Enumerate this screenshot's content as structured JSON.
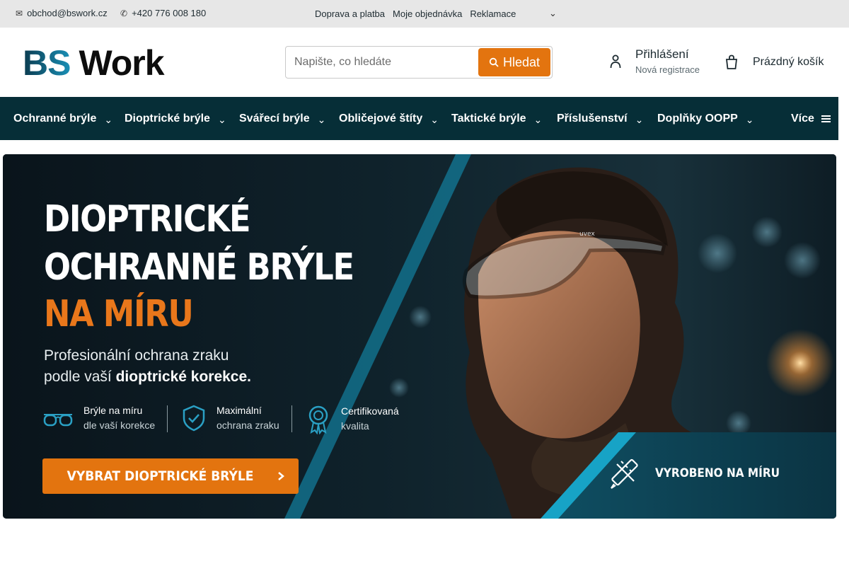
{
  "topbar": {
    "email": "obchod@bswork.cz",
    "email_icon": "mail-icon",
    "phone": "+420 776 008 180",
    "phone_icon": "phone-icon",
    "links": [
      "Doprava a platba",
      "Moje objednávka",
      "Reklamace"
    ],
    "more_icon": "chevron-down-icon"
  },
  "header": {
    "logo_bs": "BS",
    "logo_work": "Work",
    "search_placeholder": "Napište, co hledáte",
    "search_button": "Hledat",
    "login_title": "Přihlášení",
    "login_sub": "Nová registrace",
    "cart_label": "Prázdný košík"
  },
  "nav": {
    "items": [
      "Ochranné brýle",
      "Dioptrické brýle",
      "Svářecí brýle",
      "Obličejové štíty",
      "Taktické brýle",
      "Příslušenství",
      "Doplňky OOPP"
    ],
    "more": "Více"
  },
  "banner": {
    "title_line1": "DIOPTRICKÉ",
    "title_line2": "OCHRANNÉ BRÝLE",
    "title_line3": "NA MÍRU",
    "subtitle_line1": "Profesionální ochrana zraku",
    "subtitle_line2_pre": "podle vaší ",
    "subtitle_line2_bold": "dioptrické korekce.",
    "features": [
      {
        "icon": "glasses-icon",
        "title": "Brýle na míru",
        "sub": "dle vaší korekce"
      },
      {
        "icon": "shield-check-icon",
        "title": "Maximální",
        "sub": "ochrana zraku"
      },
      {
        "icon": "certificate-badge-icon",
        "title": "Certifikovaná",
        "sub": "kvalita"
      }
    ],
    "cta": "VYBRAT DIOPTRICKÉ BRÝLE",
    "made_label": "VYROBENO NA MÍRU",
    "glasses_brand": "uvex",
    "colors": {
      "accent": "#e3740f",
      "nav": "#062e37",
      "teal": "#13809f"
    }
  }
}
